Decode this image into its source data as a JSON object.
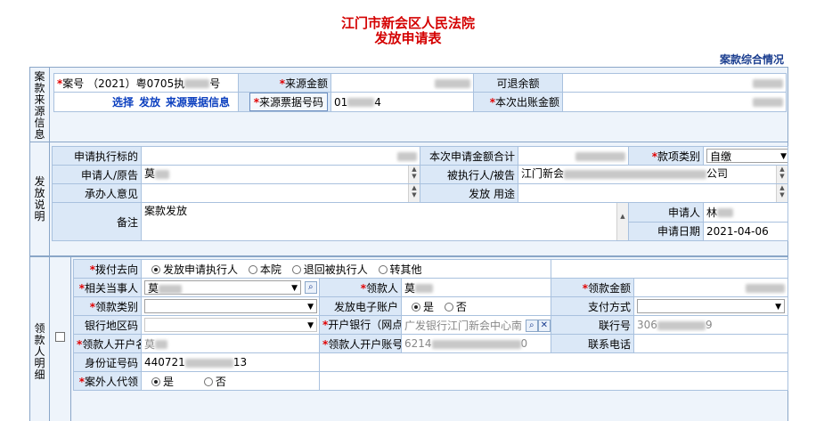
{
  "page": {
    "title_line1": "江门市新会区人民法院",
    "title_line2": "发放申请表",
    "summary_link": "案款综合情况"
  },
  "source_section": {
    "label": "案款来源信息",
    "case_no_label": "案号",
    "case_no_value_prefix": "（2021）粤0705执",
    "case_no_value_suffix": "号",
    "source_amount_label": "来源金额",
    "refundable_label": "可退余额",
    "actions": [
      "选择",
      "发放",
      "来源票据信息"
    ],
    "receipt_no_label": "来源票据号码",
    "receipt_no_prefix": "01",
    "receipt_no_suffix": "4",
    "payout_amount_label": "本次出账金额"
  },
  "release_section": {
    "label": "发放说明",
    "target_label": "申请执行标的",
    "total_label": "本次申请金额合计",
    "type_label": "款项类别",
    "type_value": "自缴",
    "applicant_label": "申请人/原告",
    "applicant_value": "莫",
    "respondent_label": "被执行人/被告",
    "respondent_prefix": "江门新会",
    "respondent_suffix": "公司",
    "opinion_label": "承办人意见",
    "purpose_label": "发放 用途",
    "remark_label": "备注",
    "remark_value": "案款发放",
    "requester_label": "申请人",
    "requester_value": "林",
    "date_label": "申请日期",
    "date_value": "2021-04-06"
  },
  "payee_section": {
    "label": "领款人明细",
    "direction_label": "拨付去向",
    "direction_options": [
      "发放申请执行人",
      "本院",
      "退回被执行人",
      "转其他"
    ],
    "direction_selected": 0,
    "party_label": "相关当事人",
    "party_value": "莫",
    "payee_label": "领款人",
    "payee_value": "莫",
    "amount_label": "领款金额",
    "category_label": "领款类别",
    "e_account_label": "发放电子账户",
    "yes_label": "是",
    "no_label": "否",
    "pay_method_label": "支付方式",
    "bank_region_label": "银行地区码",
    "bank_label": "开户银行（网点）",
    "bank_value": "广发银行江门新会中心南",
    "bank_no_label": "联行号",
    "bank_no_prefix": "306",
    "bank_no_suffix": "9",
    "account_name_label": "领款人开户名",
    "account_name_value": "莫",
    "account_no_label": "领款人开户账号",
    "account_no_prefix": "6214",
    "account_no_suffix": "0",
    "phone_label": "联系电话",
    "id_label": "身份证号码",
    "id_prefix": "440721",
    "id_suffix": "13",
    "proxy_label": "案外人代领"
  }
}
